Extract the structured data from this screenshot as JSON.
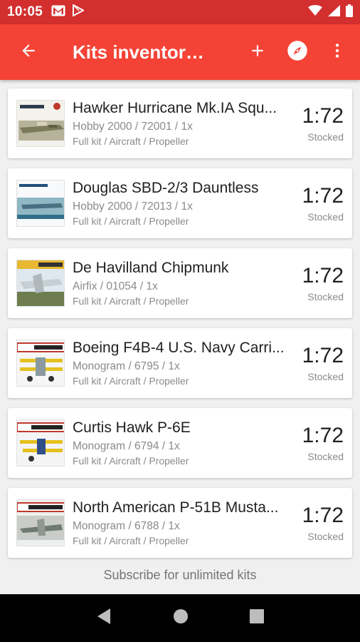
{
  "status_bar": {
    "time": "10:05",
    "icons": [
      "gmail-icon",
      "play-store-icon",
      "wifi-icon",
      "signal-icon",
      "battery-icon"
    ]
  },
  "app_bar": {
    "title": "Kits inventory...",
    "icons": {
      "back": "arrow-back-icon",
      "add": "add-icon",
      "explore": "compass-icon",
      "more": "more-vert-icon"
    }
  },
  "colors": {
    "status_bar": "#d32f2f",
    "app_bar": "#f44336",
    "background": "#f0f0f0",
    "card": "#ffffff",
    "nav_bar": "#000000"
  },
  "kits": [
    {
      "name": "Hawker Hurricane Mk.IA Squ...",
      "brand_line": "Hobby 2000 / 72001 / 1x",
      "type_line": "Full kit / Aircraft / Propeller",
      "scale": "1:72",
      "status": "Stocked"
    },
    {
      "name": "Douglas SBD-2/3 Dauntless",
      "brand_line": "Hobby 2000 / 72013 / 1x",
      "type_line": "Full kit / Aircraft / Propeller",
      "scale": "1:72",
      "status": "Stocked"
    },
    {
      "name": "De Havilland Chipmunk",
      "brand_line": "Airfix / 01054 / 1x",
      "type_line": "Full kit / Aircraft / Propeller",
      "scale": "1:72",
      "status": "Stocked"
    },
    {
      "name": "Boeing F4B-4 U.S. Navy Carri...",
      "brand_line": "Monogram / 6795 / 1x",
      "type_line": "Full kit / Aircraft / Propeller",
      "scale": "1:72",
      "status": "Stocked"
    },
    {
      "name": "Curtis Hawk P-6E",
      "brand_line": "Monogram / 6794 / 1x",
      "type_line": "Full kit / Aircraft / Propeller",
      "scale": "1:72",
      "status": "Stocked"
    },
    {
      "name": "North American P-51B Musta...",
      "brand_line": "Monogram / 6788 / 1x",
      "type_line": "Full kit / Aircraft / Propeller",
      "scale": "1:72",
      "status": "Stocked"
    }
  ],
  "footer": {
    "subscribe_text": "Subscribe for unlimited kits"
  },
  "nav_bar": {
    "icons": [
      "nav-back-icon",
      "nav-home-icon",
      "nav-recents-icon"
    ]
  }
}
